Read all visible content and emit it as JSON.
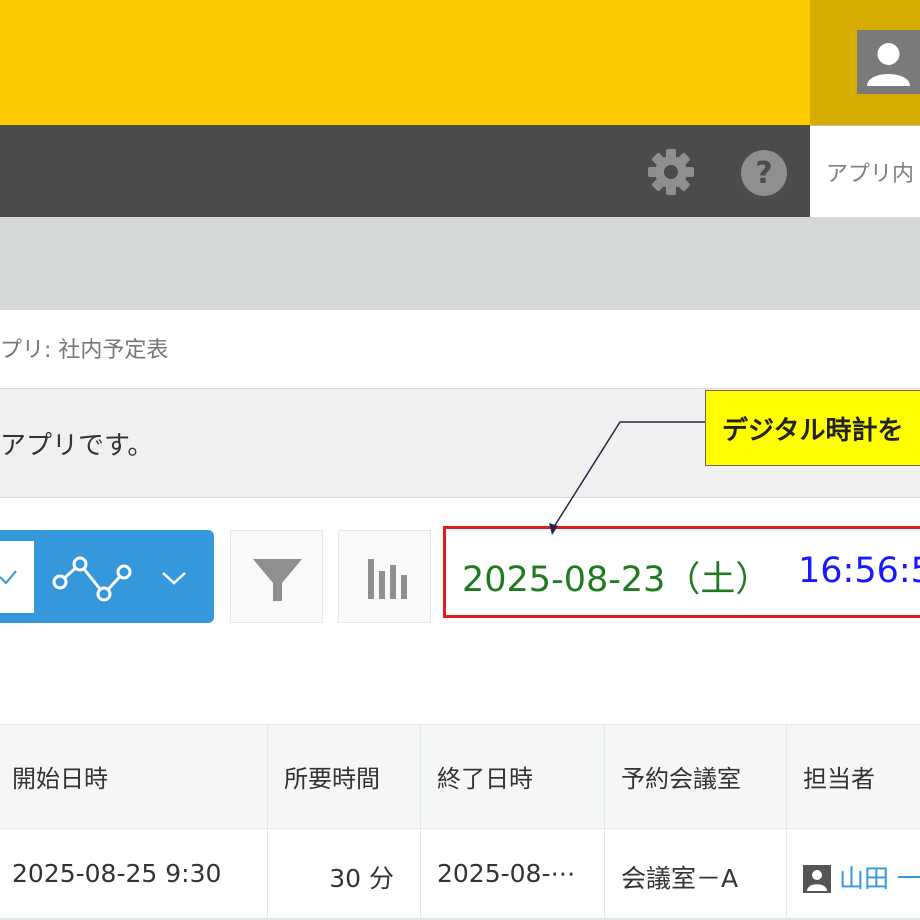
{
  "header": {
    "search_placeholder": "アプリ内"
  },
  "app": {
    "label": "プリ: 社内予定表",
    "description": "アプリです。"
  },
  "clock": {
    "date": "2025-08-23（土）",
    "time": "16:56:5"
  },
  "callout": {
    "text": "デジタル時計を"
  },
  "table": {
    "columns": [
      "開始日時",
      "所要時間",
      "終了日時",
      "予約会議室",
      "担当者"
    ],
    "rows": [
      [
        "2025-08-25 9:30",
        "30 分",
        "2025-08-⋯",
        "会議室－A",
        "山田 一"
      ]
    ]
  },
  "colors": {
    "header_yellow": "#fbcb00",
    "nav_dark": "#4b4b4b",
    "accent_blue": "#3498db",
    "highlight_red": "#e21c1c",
    "date_green": "#1e7b1e",
    "time_blue": "#1919ff"
  }
}
